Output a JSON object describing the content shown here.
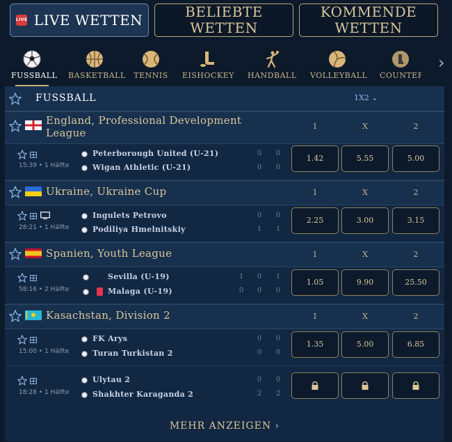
{
  "top_tabs": [
    {
      "label": "Live Wetten",
      "badge": "LIVE"
    },
    {
      "label": "Beliebte Wetten"
    },
    {
      "label": "Kommende Wetten"
    }
  ],
  "sports": [
    "Fussball",
    "Basketball",
    "Tennis",
    "Eishockey",
    "Handball",
    "Volleyball",
    "Counter"
  ],
  "section": {
    "title": "FUSSBALL",
    "market": "1X2"
  },
  "odds_cols": [
    "1",
    "X",
    "2"
  ],
  "leagues": [
    {
      "name": "England, Professional Development League",
      "matches": [
        {
          "time": "15:39",
          "half": "1 Hälfte",
          "home": "Peterborough United (U-21)",
          "away": "Wigan Athletic (U-21)",
          "home_scores": [
            "0",
            "0"
          ],
          "away_scores": [
            "0",
            "0"
          ],
          "odds": [
            "1.42",
            "5.55",
            "5.00"
          ]
        }
      ]
    },
    {
      "name": "Ukraine, Ukraine Cup",
      "matches": [
        {
          "time": "28:21",
          "half": "1 Hälfte",
          "home": "Ingulets Petrovo",
          "away": "Podiliya Hmelnitskiy",
          "home_scores": [
            "0",
            "0"
          ],
          "away_scores": [
            "1",
            "1"
          ],
          "odds": [
            "2.25",
            "3.00",
            "3.15"
          ]
        }
      ]
    },
    {
      "name": "Spanien, Youth League",
      "matches": [
        {
          "time": "58:16",
          "half": "2 Hälfte",
          "home": "Sevilla (U-19)",
          "away": "Malaga (U-19)",
          "home_scores": [
            "1",
            "0",
            "1"
          ],
          "away_scores": [
            "0",
            "0",
            "0"
          ],
          "odds": [
            "1.05",
            "9.90",
            "25.50"
          ]
        }
      ]
    },
    {
      "name": "Kasachstan, Division 2",
      "matches": [
        {
          "time": "15:00",
          "half": "1 Hälfte",
          "home": "FK Arys",
          "away": "Turan Turkistan 2",
          "home_scores": [
            "0",
            "0"
          ],
          "away_scores": [
            "0",
            "0"
          ],
          "odds": [
            "1.35",
            "5.00",
            "6.85"
          ]
        },
        {
          "time": "18:28",
          "half": "1 Hälfte",
          "home": "Ulytau 2",
          "away": "Shakhter Karaganda 2",
          "home_scores": [
            "0",
            "0"
          ],
          "away_scores": [
            "2",
            "2"
          ],
          "odds": [
            "locked",
            "locked",
            "locked"
          ]
        }
      ]
    }
  ],
  "more_label": "Mehr anzeigen"
}
